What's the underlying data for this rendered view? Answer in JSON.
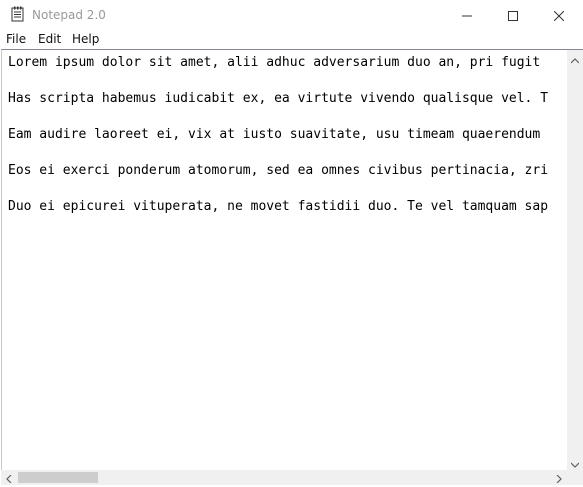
{
  "window": {
    "title": "Notepad 2.0",
    "icons": {
      "app": "notepad-icon",
      "minimize": "minimize-icon",
      "maximize": "maximize-icon",
      "close": "close-icon"
    }
  },
  "menu": {
    "items": [
      {
        "label": "File"
      },
      {
        "label": "Edit"
      },
      {
        "label": "Help"
      }
    ]
  },
  "editor": {
    "lines": [
      "Lorem ipsum dolor sit amet, alii adhuc adversarium duo an, pri fugit",
      "Has scripta habemus iudicabit ex, ea virtute vivendo qualisque vel. T",
      "Eam audire laoreet ei, vix at iusto suavitate, usu timeam quaerendum",
      "Eos ei exerci ponderum atomorum, sed ea omnes civibus pertinacia, zri",
      "Duo ei epicurei vituperata, ne movet fastidii duo. Te vel tamquam sap"
    ]
  },
  "colors": {
    "title_text": "#999999",
    "scrollbar_track": "#f0f0f0",
    "scrollbar_thumb": "#cdcdcd"
  }
}
